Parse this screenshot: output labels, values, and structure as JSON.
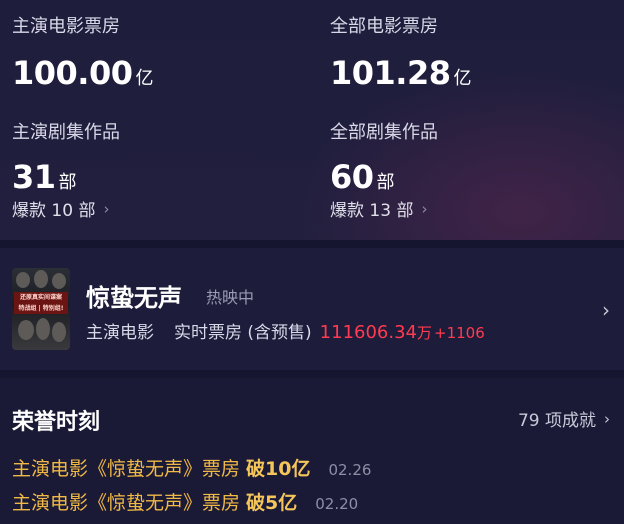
{
  "stats": {
    "lead_box_office": {
      "label": "主演电影票房",
      "value": "100.00",
      "unit": "亿"
    },
    "all_box_office": {
      "label": "全部电影票房",
      "value": "101.28",
      "unit": "亿"
    },
    "lead_series": {
      "label": "主演剧集作品",
      "value": "31",
      "unit": "部",
      "sub": "爆款 10 部"
    },
    "all_series": {
      "label": "全部剧集作品",
      "value": "60",
      "unit": "部",
      "sub": "爆款 13 部"
    }
  },
  "movie": {
    "title": "惊蛰无声",
    "status": "热映中",
    "role": "主演电影",
    "box_label": "实时票房 (含预售)",
    "box_value": "111606.34",
    "box_unit": "万",
    "box_delta": "+1106",
    "poster_text_1": "还原真实间谍案",
    "poster_text_2": "特战组 | 特别组!"
  },
  "honor": {
    "title": "荣誉时刻",
    "count": "79 项成就",
    "items": [
      {
        "text": "主演电影《惊蛰无声》票房",
        "achievement": "破10亿",
        "date": "02.26"
      },
      {
        "text": "主演电影《惊蛰无声》票房",
        "achievement": "破5亿",
        "date": "02.20"
      }
    ]
  },
  "colors": {
    "accent_red": "#ff3b50",
    "honor_gold": "#f0b845",
    "background": "#1b1a36"
  },
  "icons": {
    "chevron": "chevron-right-icon"
  }
}
